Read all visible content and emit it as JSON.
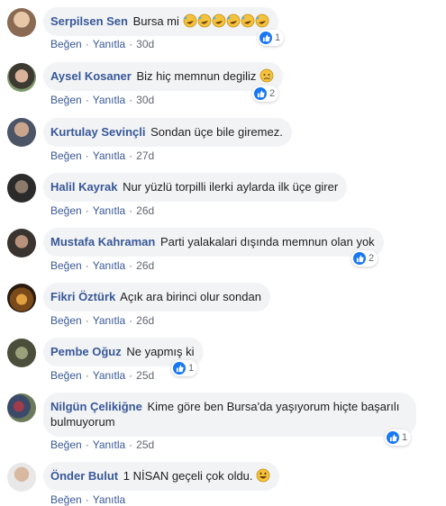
{
  "labels": {
    "like": "Beğen",
    "reply": "Yanıtla",
    "sep": "·"
  },
  "comments": [
    {
      "author": "Serpilsen Sen",
      "text": "Bursa mi",
      "time": "30d",
      "reactions": "1",
      "emoji": "rofl",
      "emoji_count": 6
    },
    {
      "author": "Aysel Kosaner",
      "text": "Biz hiç memnun degiliz",
      "time": "30d",
      "reactions": "2",
      "emoji": "sad"
    },
    {
      "author": "Kurtulay Sevinçli",
      "text": "Sondan üçe bile giremez.",
      "time": "27d"
    },
    {
      "author": "Halil Kayrak",
      "text": "Nur yüzlü torpilli ilerki aylarda ilk üçe girer",
      "time": "26d"
    },
    {
      "author": "Mustafa Kahraman",
      "text": "Parti yalakalari dışında memnun olan yok",
      "time": "26d",
      "reactions": "2"
    },
    {
      "author": "Fikri Öztürk",
      "text": "Açık ara birinci olur sondan",
      "time": "26d"
    },
    {
      "author": "Pembe Oğuz",
      "text": "Ne yapmış ki",
      "time": "25d",
      "reactions": "1"
    },
    {
      "author": "Nilgün Çelikiğne",
      "text": "Kime göre ben Bursa'da yaşıyorum hiçte başarılı bulmuyorum",
      "time": "25d",
      "reactions": "1"
    },
    {
      "author": "Önder Bulut",
      "text": "1 NİSAN geçeli çok oldu.",
      "time": "",
      "emoji": "grin"
    }
  ]
}
